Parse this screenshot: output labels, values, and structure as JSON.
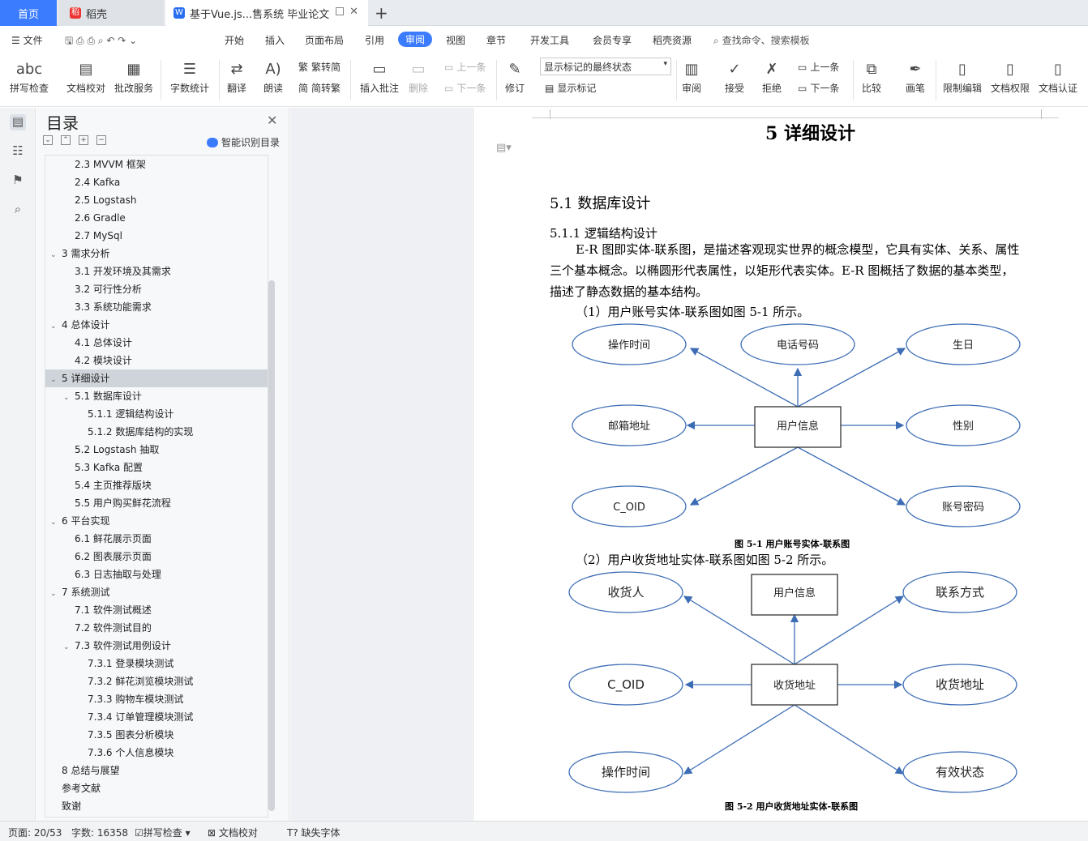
{
  "tabs": {
    "home": "首页",
    "doc1": "稻壳",
    "doc2": "基于Vue.js...售系统 毕业论文"
  },
  "menu": {
    "file": "文件",
    "items": [
      "开始",
      "插入",
      "页面布局",
      "引用",
      "审阅",
      "视图",
      "章节",
      "开发工具",
      "会员专享",
      "稻壳资源"
    ],
    "active": "审阅",
    "search": "查找命令、搜索模板"
  },
  "ribbon": {
    "spell": "拼写检查",
    "proof": "文档校对",
    "correct": "批改服务",
    "wordcount": "字数统计",
    "translate": "翻译",
    "read": "朗读",
    "trad": "繁转简",
    "simp": "简转繁",
    "insert_comment": "插入批注",
    "delete": "删除",
    "prev": "上一条",
    "next": "下一条",
    "revise": "修订",
    "show_select": "显示标记的最终状态",
    "show_marks": "显示标记",
    "review": "审阅",
    "accept": "接受",
    "reject": "拒绝",
    "prev2": "上一条",
    "next2": "下一条",
    "compare": "比较",
    "pen": "画笔",
    "restrict": "限制编辑",
    "rights": "文档权限",
    "cert": "文档认证"
  },
  "toc": {
    "title": "目录",
    "smart": "智能识别目录",
    "items": [
      {
        "text": "2.3 MVVM 框架",
        "level": 2
      },
      {
        "text": "2.4 Kafka",
        "level": 2
      },
      {
        "text": "2.5 Logstash",
        "level": 2
      },
      {
        "text": "2.6 Gradle",
        "level": 2
      },
      {
        "text": "2.7 MySql",
        "level": 2
      },
      {
        "text": "3 需求分析",
        "level": 1,
        "chev": true
      },
      {
        "text": "3.1 开发环境及其需求",
        "level": 2
      },
      {
        "text": "3.2 可行性分析",
        "level": 2
      },
      {
        "text": "3.3 系统功能需求",
        "level": 2
      },
      {
        "text": "4 总体设计",
        "level": 1,
        "chev": true
      },
      {
        "text": "4.1 总体设计",
        "level": 2
      },
      {
        "text": "4.2 模块设计",
        "level": 2
      },
      {
        "text": "5 详细设计",
        "level": 1,
        "chev": true,
        "selected": true
      },
      {
        "text": "5.1 数据库设计",
        "level": 2,
        "chev": true
      },
      {
        "text": "5.1.1 逻辑结构设计",
        "level": 3
      },
      {
        "text": "5.1.2 数据库结构的实现",
        "level": 3
      },
      {
        "text": "5.2 Logstash 抽取",
        "level": 2
      },
      {
        "text": "5.3 Kafka 配置",
        "level": 2
      },
      {
        "text": "5.4 主页推荐版块",
        "level": 2
      },
      {
        "text": "5.5 用户购买鲜花流程",
        "level": 2
      },
      {
        "text": "6 平台实现",
        "level": 1,
        "chev": true
      },
      {
        "text": "6.1 鲜花展示页面",
        "level": 2
      },
      {
        "text": "6.2 图表展示页面",
        "level": 2
      },
      {
        "text": "6.3 日志抽取与处理",
        "level": 2
      },
      {
        "text": "7 系统测试",
        "level": 1,
        "chev": true
      },
      {
        "text": "7.1 软件测试概述",
        "level": 2
      },
      {
        "text": "7.2 软件测试目的",
        "level": 2
      },
      {
        "text": "7.3 软件测试用例设计",
        "level": 2,
        "chev": true
      },
      {
        "text": "7.3.1 登录模块测试",
        "level": 3
      },
      {
        "text": "7.3.2 鲜花浏览模块测试",
        "level": 3
      },
      {
        "text": "7.3.3 购物车模块测试",
        "level": 3
      },
      {
        "text": "7.3.4 订单管理模块测试",
        "level": 3
      },
      {
        "text": "7.3.5 图表分析模块",
        "level": 3
      },
      {
        "text": "7.3.6 个人信息模块",
        "level": 3
      },
      {
        "text": "8 总结与展望",
        "level": 1
      },
      {
        "text": "参考文献",
        "level": 1
      },
      {
        "text": "致谢",
        "level": 1
      }
    ]
  },
  "doc": {
    "h1": "5 详细设计",
    "h2": "5.1 数据库设计",
    "h3": "5.1.1 逻辑结构设计",
    "p1": "E-R 图即实体-联系图，是描述客观现实世界的概念模型，它具有实体、关系、属性",
    "p2": "三个基本概念。以椭圆形代表属性，以矩形代表实体。E-R 图概括了数据的基本类型，",
    "p3": "描述了静态数据的基本结构。",
    "p4": "（1）用户账号实体-联系图如图 5-1 所示。",
    "d1": {
      "center": "用户信息",
      "tl": "操作时间",
      "tc": "电话号码",
      "tr": "生日",
      "ml": "邮箱地址",
      "mr": "性别",
      "bl": "C_OID",
      "br": "账号密码"
    },
    "cap1": "图 5-1 用户账号实体-联系图",
    "p5": "（2）用户收货地址实体-联系图如图 5-2 所示。",
    "d2": {
      "center": "收货地址",
      "tl": "收货人",
      "tc": "用户信息",
      "tr": "联系方式",
      "ml": "C_OID",
      "mr": "收货地址",
      "bl": "操作时间",
      "br": "有效状态"
    },
    "cap2": "图 5-2 用户收货地址实体-联系图"
  },
  "status": {
    "page": "页面: 20/53",
    "words": "字数: 16358",
    "spell": "拼写检查",
    "proof": "文档校对",
    "font": "缺失字体"
  }
}
